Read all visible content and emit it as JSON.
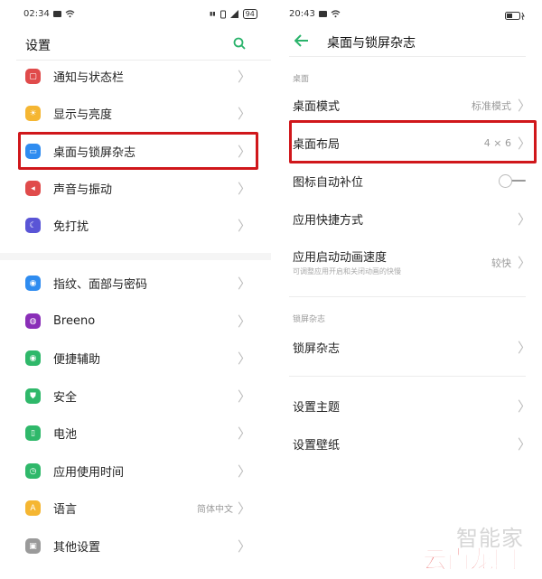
{
  "left": {
    "status": {
      "time": "02:34",
      "battery": "94"
    },
    "title": "设置",
    "items": [
      {
        "label": "通知与状态栏",
        "icon": "notification-icon",
        "color": "#e04b4b"
      },
      {
        "label": "显示与亮度",
        "icon": "brightness-icon",
        "color": "#f5b632"
      },
      {
        "label": "桌面与锁屏杂志",
        "icon": "wallpaper-icon",
        "color": "#2f8cf0"
      },
      {
        "label": "声音与振动",
        "icon": "sound-icon",
        "color": "#e04b4b"
      },
      {
        "label": "免打扰",
        "icon": "moon-icon",
        "color": "#5a55d6"
      },
      {
        "label": "指纹、面部与密码",
        "icon": "fingerprint-icon",
        "color": "#2f8cf0"
      },
      {
        "label": "Breeno",
        "icon": "breeno-icon",
        "color": "#8a2fb8"
      },
      {
        "label": "便捷辅助",
        "icon": "assist-icon",
        "color": "#2fb86a"
      },
      {
        "label": "安全",
        "icon": "shield-icon",
        "color": "#2fb86a"
      },
      {
        "label": "电池",
        "icon": "battery-icon",
        "color": "#2fb86a"
      },
      {
        "label": "应用使用时间",
        "icon": "app-time-icon",
        "color": "#2fb86a"
      },
      {
        "label": "语言",
        "icon": "language-icon",
        "color": "#f5b632",
        "value": "简体中文"
      },
      {
        "label": "其他设置",
        "icon": "other-settings-icon",
        "color": "#9a9a9a"
      }
    ]
  },
  "right": {
    "status": {
      "time": "20:43"
    },
    "title": "桌面与锁屏杂志",
    "section1": "桌面",
    "desktop_mode": {
      "label": "桌面模式",
      "value": "标准模式"
    },
    "desktop_layout": {
      "label": "桌面布局",
      "value": "4 × 6"
    },
    "auto_fill": {
      "label": "图标自动补位",
      "toggle_on": false
    },
    "shortcuts": {
      "label": "应用快捷方式"
    },
    "anim_speed": {
      "label": "应用启动动画速度",
      "sub": "可调整应用开启和关闭动画的快慢",
      "value": "较快"
    },
    "section2": "锁屏杂志",
    "lock_magazine": {
      "label": "锁屏杂志"
    },
    "theme": {
      "label": "设置主题"
    },
    "wallpaper": {
      "label": "设置壁纸"
    }
  },
  "watermark": {
    "top": "智能家",
    "bottom": "云南龙网"
  },
  "colors": {
    "highlight": "#d0171b",
    "accent_green": "#2ab36b"
  }
}
